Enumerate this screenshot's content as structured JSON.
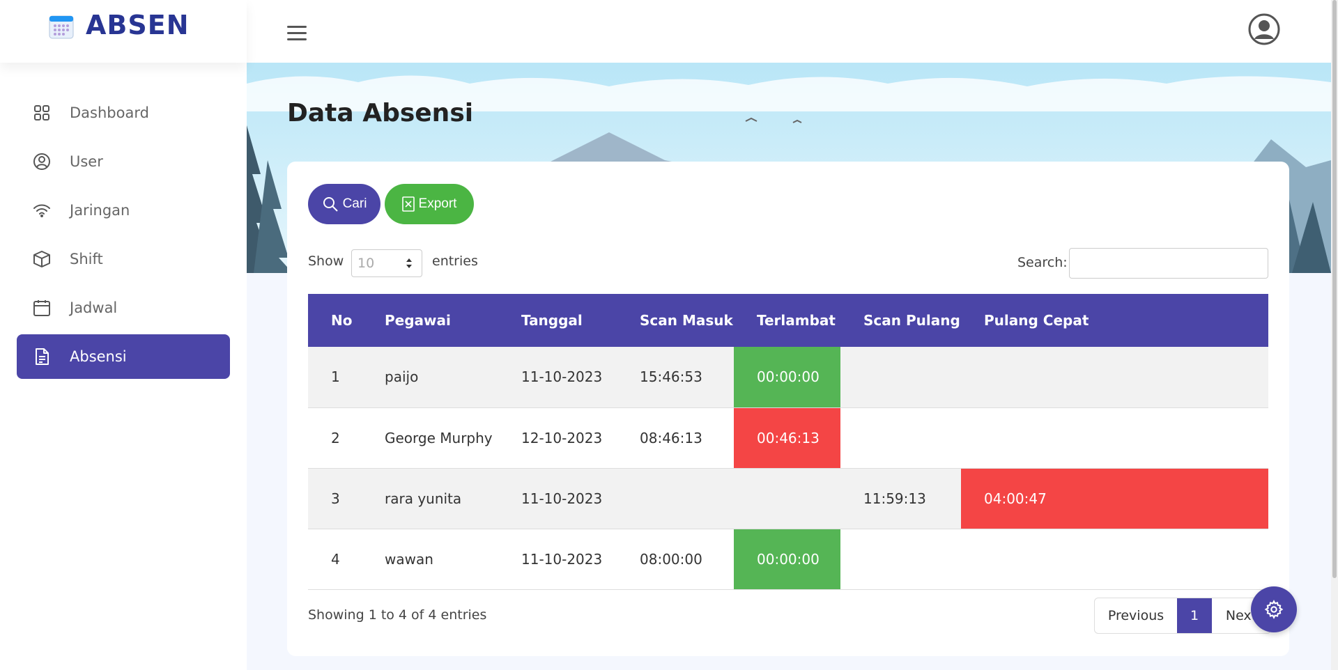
{
  "app": {
    "name": "ABSEN"
  },
  "sidebar": {
    "items": [
      {
        "label": "Dashboard",
        "icon": "grid-icon",
        "active": false
      },
      {
        "label": "User",
        "icon": "user-circle-icon",
        "active": false
      },
      {
        "label": "Jaringan",
        "icon": "wifi-icon",
        "active": false
      },
      {
        "label": "Shift",
        "icon": "box-icon",
        "active": false
      },
      {
        "label": "Jadwal",
        "icon": "calendar-icon",
        "active": false
      },
      {
        "label": "Absensi",
        "icon": "document-icon",
        "active": true
      }
    ]
  },
  "page": {
    "title": "Data Absensi"
  },
  "toolbar": {
    "cari_label": "Cari",
    "export_label": "Export"
  },
  "table_controls": {
    "show_label": "Show",
    "page_size": "10",
    "entries_label": "entries",
    "search_label": "Search:"
  },
  "table": {
    "headers": [
      "No",
      "Pegawai",
      "Tanggal",
      "Scan Masuk",
      "Terlambat",
      "Scan Pulang",
      "Pulang Cepat"
    ],
    "rows": [
      {
        "no": "1",
        "pegawai": "paijo",
        "tanggal": "11-10-2023",
        "scan_masuk": "15:46:53",
        "terlambat": "00:00:00",
        "scan_pulang": "",
        "pulang_cepat": ""
      },
      {
        "no": "2",
        "pegawai": "George Murphy",
        "tanggal": "12-10-2023",
        "scan_masuk": "08:46:13",
        "terlambat": "00:46:13",
        "scan_pulang": "",
        "pulang_cepat": ""
      },
      {
        "no": "3",
        "pegawai": "rara yunita",
        "tanggal": "11-10-2023",
        "scan_masuk": "",
        "terlambat": "",
        "scan_pulang": "11:59:13",
        "pulang_cepat": "04:00:47"
      },
      {
        "no": "4",
        "pegawai": "wawan",
        "tanggal": "11-10-2023",
        "scan_masuk": "08:00:00",
        "terlambat": "00:00:00",
        "scan_pulang": "",
        "pulang_cepat": ""
      }
    ]
  },
  "footer": {
    "info": "Showing 1 to 4 of 4 entries",
    "previous": "Previous",
    "page": "1",
    "next": "Next"
  },
  "colors": {
    "primary": "#4b45a7",
    "success": "#55b555",
    "danger": "#f44545",
    "brand_text": "#283593"
  }
}
